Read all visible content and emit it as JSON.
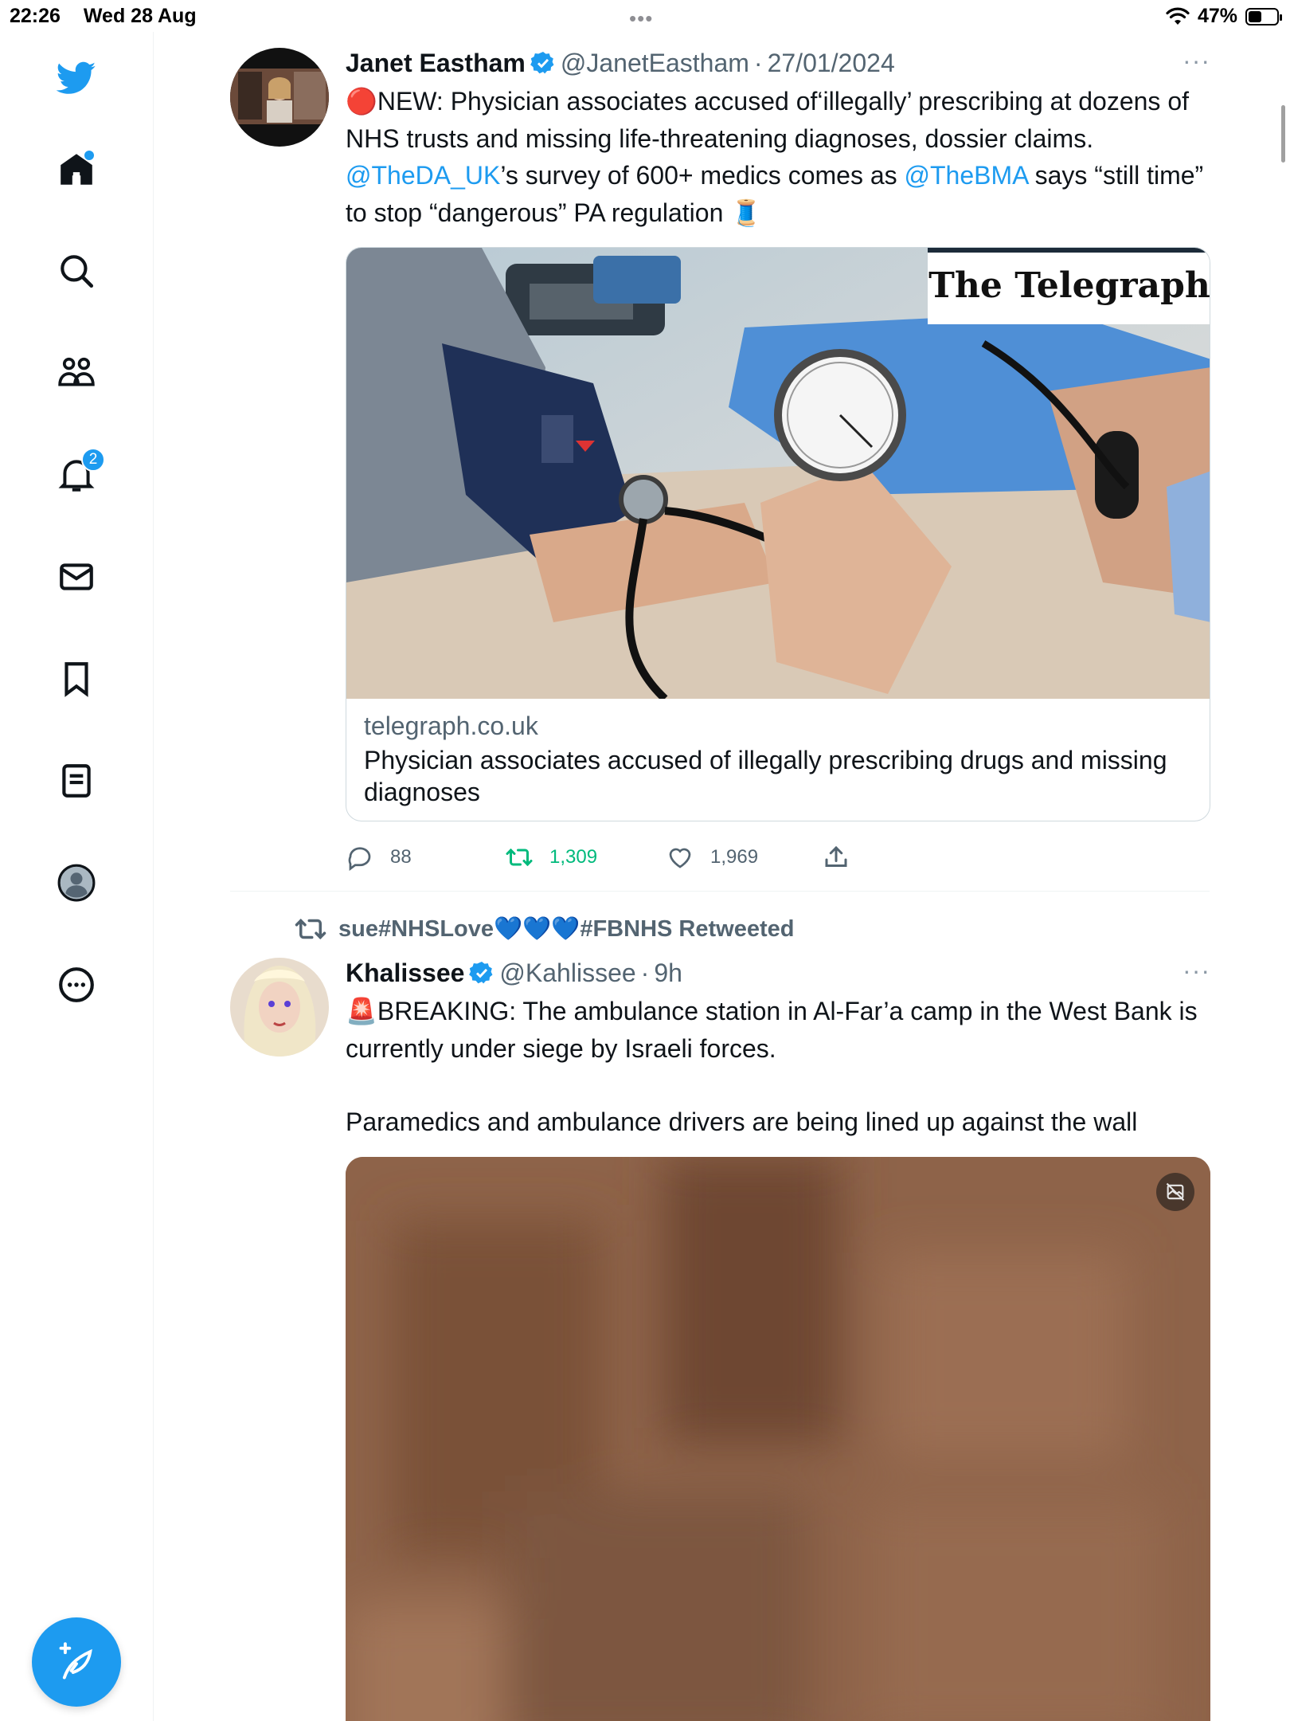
{
  "status_bar": {
    "time": "22:26",
    "date": "Wed 28 Aug",
    "battery": "47%",
    "battery_level": 0.47
  },
  "sidebar": {
    "items": [
      {
        "icon": "twitter-bird-icon"
      },
      {
        "icon": "home-icon",
        "has_dot": true
      },
      {
        "icon": "search-icon"
      },
      {
        "icon": "communities-icon"
      },
      {
        "icon": "notifications-bell-icon",
        "badge": "2"
      },
      {
        "icon": "messages-envelope-icon"
      },
      {
        "icon": "bookmark-icon"
      },
      {
        "icon": "lists-icon"
      },
      {
        "icon": "profile-avatar-icon"
      },
      {
        "icon": "more-circle-icon"
      }
    ],
    "compose_icon": "compose-feather-icon"
  },
  "colors": {
    "accent": "#1d9bf0",
    "retweet_green": "#00ba7c",
    "secondary_text": "#536471",
    "telegraph_bar": "#1c2b39"
  },
  "tweets": [
    {
      "name": "Janet Eastham",
      "handle": "@JanetEastham",
      "separator": "·",
      "time": "27/01/2024",
      "more": "···",
      "text_lead": "🔴NEW: Physician associates accused of‘illegally’ prescribing at dozens of NHS trusts and missing life-threatening diagnoses, dossier claims. ",
      "mention1": "@TheDA_UK",
      "text_mid": "’s survey of 600+ medics comes as ",
      "mention2": "@TheBMA",
      "text_tail": " says “still time” to stop “dangerous” PA regulation 🧵",
      "card": {
        "image_brand": "The Telegraph",
        "domain": "telegraph.co.uk",
        "title": "Physician associates accused of illegally prescribing drugs and missing diagnoses"
      },
      "replies": "88",
      "retweets": "1,309",
      "likes": "1,969"
    },
    {
      "retweeted_by": "sue#NHSLove💙💙💙#FBNHS Retweeted",
      "name": "Khalissee",
      "handle": "@Kahlissee",
      "separator": "·",
      "time": "9h",
      "more": "···",
      "text_line1": "🚨BREAKING: The ambulance station in Al-Far’a camp in the West Bank is currently under siege by Israeli forces.",
      "text_line2": "Paramedics and ambulance drivers are being lined up against the wall"
    }
  ]
}
